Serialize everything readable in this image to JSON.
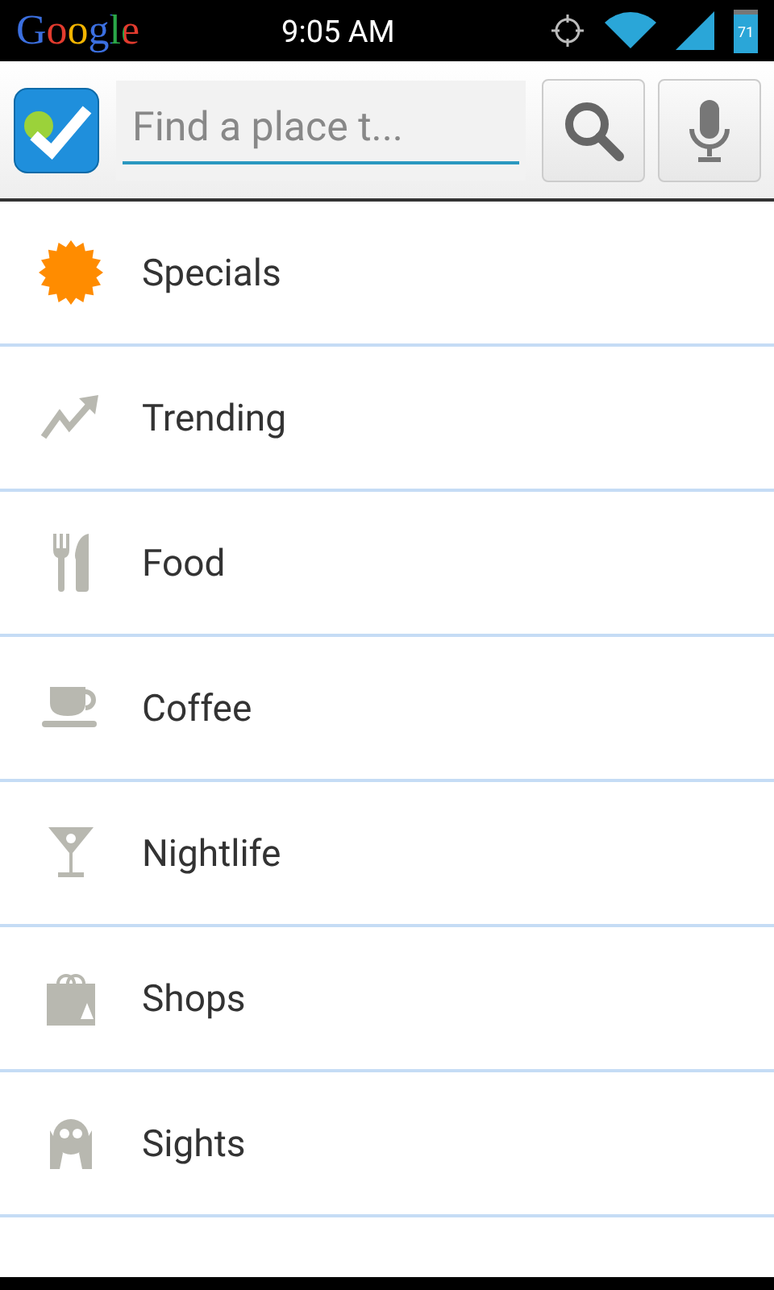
{
  "status_bar": {
    "logo": "Google",
    "time": "9:05 AM",
    "battery": "71"
  },
  "search": {
    "placeholder": "Find a place t..."
  },
  "categories": [
    {
      "label": "Specials",
      "kind": "specials"
    },
    {
      "label": "Trending",
      "kind": "trending"
    },
    {
      "label": "Food",
      "kind": "food"
    },
    {
      "label": "Coffee",
      "kind": "coffee"
    },
    {
      "label": "Nightlife",
      "kind": "nightlife"
    },
    {
      "label": "Shops",
      "kind": "shops"
    },
    {
      "label": "Sights",
      "kind": "sights"
    }
  ]
}
